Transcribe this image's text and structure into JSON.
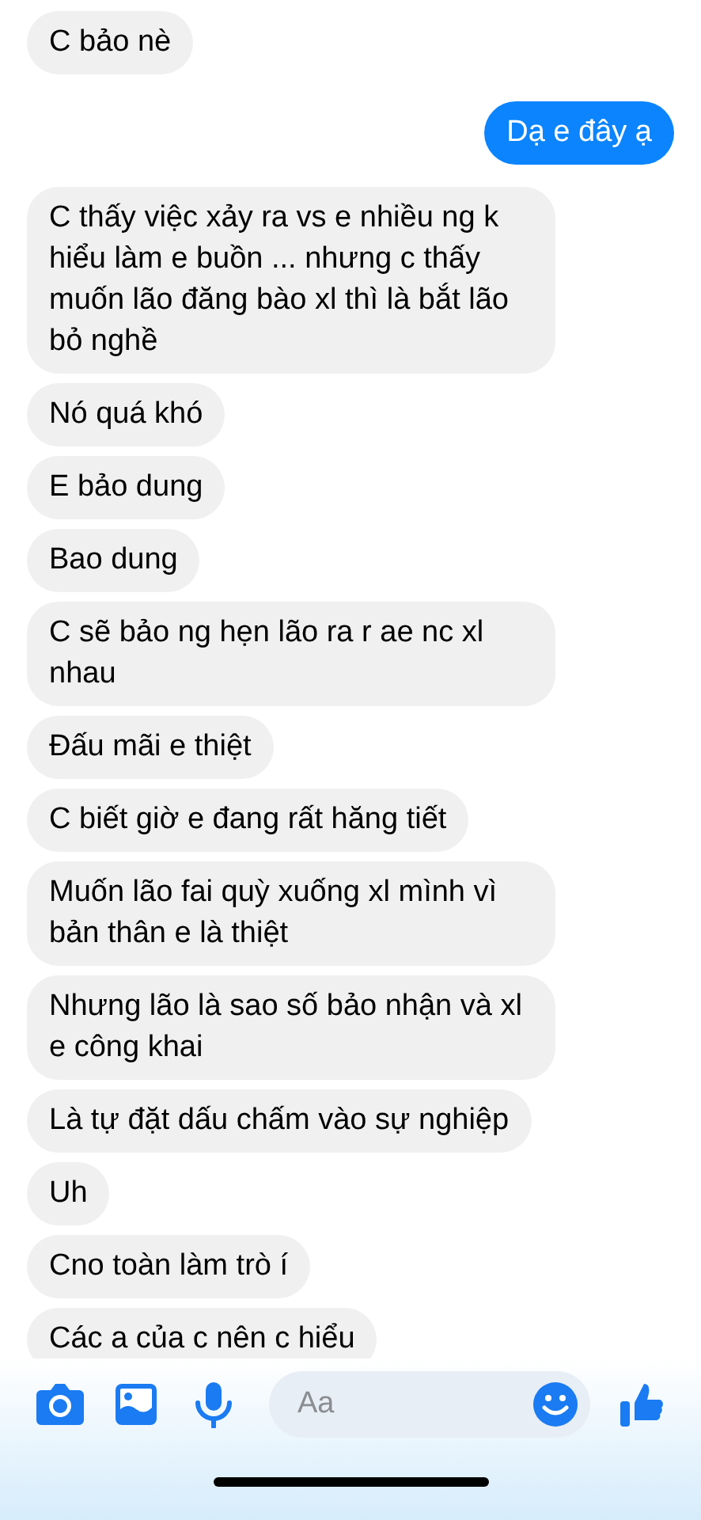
{
  "messages": [
    {
      "kind": "received",
      "text": "C bảo nè"
    },
    {
      "kind": "sent",
      "text": "Dạ e đây ạ"
    },
    {
      "kind": "received",
      "text": "C thấy việc xảy ra vs e nhiều ng k hiểu làm e buồn ... nhưng c thấy muốn lão đăng bào xl thì là bắt lão bỏ nghề"
    },
    {
      "kind": "received",
      "text": "Nó quá khó"
    },
    {
      "kind": "received",
      "text": "E bảo dung"
    },
    {
      "kind": "received",
      "text": "Bao dung"
    },
    {
      "kind": "received",
      "text": "C sẽ bảo ng hẹn lão ra r ae nc xl nhau"
    },
    {
      "kind": "received",
      "text": "Đấu mãi e thiệt"
    },
    {
      "kind": "received",
      "text": "C biết giờ e đang rất hăng tiết"
    },
    {
      "kind": "received",
      "text": "Muốn lão fai quỳ xuống xl mình vì bản thân e là thiệt"
    },
    {
      "kind": "received",
      "text": "Nhưng lão là sao số bảo nhận và xl e công khai"
    },
    {
      "kind": "received",
      "text": "Là tự đặt dấu chấm vào sự nghiệp"
    },
    {
      "kind": "received",
      "text": "Uh"
    },
    {
      "kind": "received",
      "text": "Cno toàn làm trò í"
    },
    {
      "kind": "received",
      "text": "Các a của c nên c hiểu"
    }
  ],
  "composer": {
    "placeholder": "Aa"
  }
}
